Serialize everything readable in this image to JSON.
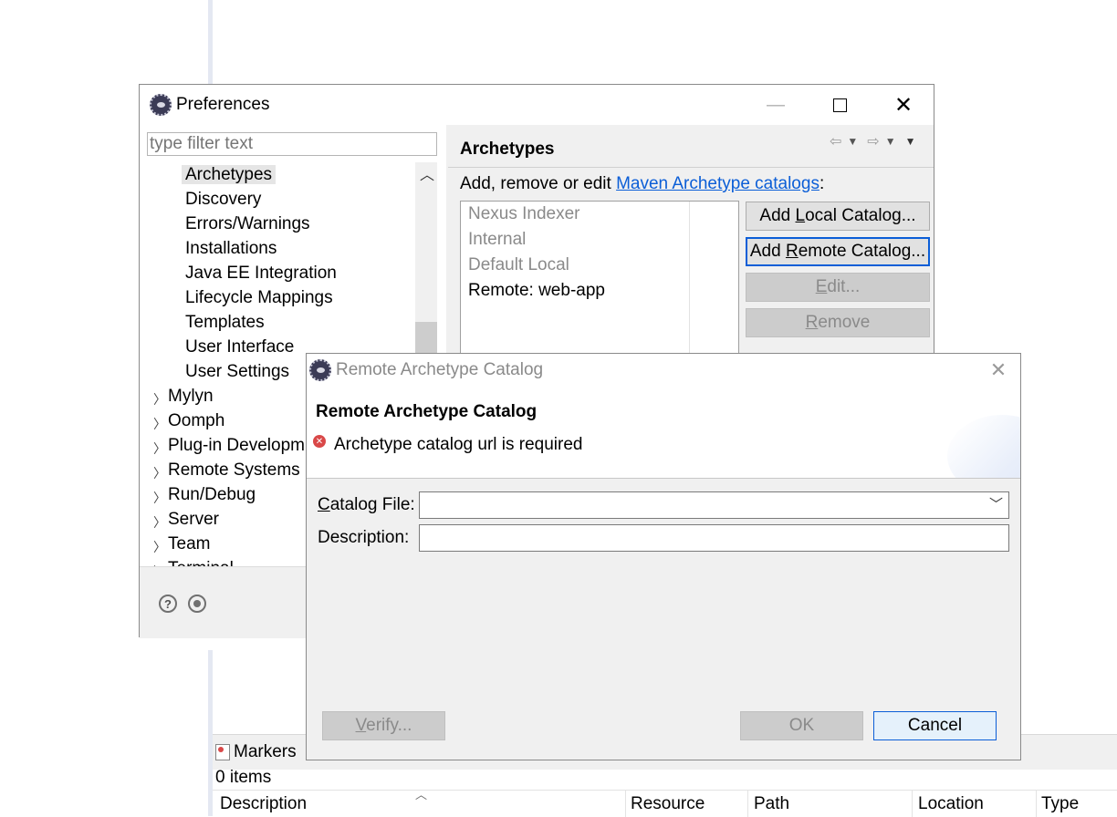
{
  "workbench": {
    "markers_tab_label": "Markers",
    "markers_count": "0 items",
    "columns": [
      "Description",
      "Resource",
      "Path",
      "Location",
      "Type"
    ]
  },
  "preferences": {
    "title": "Preferences",
    "filter_placeholder": "type filter text",
    "tree_children": [
      "Archetypes",
      "Discovery",
      "Errors/Warnings",
      "Installations",
      "Java EE Integration",
      "Lifecycle Mappings",
      "Templates",
      "User Interface",
      "User Settings"
    ],
    "tree_groups": [
      "Mylyn",
      "Oomph",
      "Plug-in Developm",
      "Remote Systems",
      "Run/Debug",
      "Server",
      "Team",
      "Terminal"
    ],
    "page_title": "Archetypes",
    "description_prefix": "Add, remove or edit ",
    "description_link": "Maven Archetype catalogs",
    "description_suffix": ":",
    "catalogs": [
      {
        "label": "Nexus Indexer",
        "enabled": false
      },
      {
        "label": "Internal",
        "enabled": false
      },
      {
        "label": "Default Local",
        "enabled": false
      },
      {
        "label": "Remote: web-app",
        "enabled": true
      }
    ],
    "buttons": {
      "add_local": {
        "before": "Add ",
        "mnemonic": "L",
        "after": "ocal Catalog..."
      },
      "add_remote": {
        "before": "Add ",
        "mnemonic": "R",
        "after": "emote Catalog..."
      },
      "edit": {
        "before": "",
        "mnemonic": "E",
        "after": "dit..."
      },
      "remove": {
        "before": "",
        "mnemonic": "R",
        "after": "emove"
      }
    }
  },
  "remote_dialog": {
    "window_title": "Remote Archetype Catalog",
    "banner_title": "Remote Archetype Catalog",
    "error_message": "Archetype catalog url is required",
    "catalog_file_label": {
      "mnemonic": "C",
      "after": "atalog File:"
    },
    "catalog_file_value": "",
    "description_label": "Description:",
    "description_value": "",
    "verify_button": {
      "mnemonic": "V",
      "after": "erify..."
    },
    "ok_button": "OK",
    "cancel_button": "Cancel"
  }
}
